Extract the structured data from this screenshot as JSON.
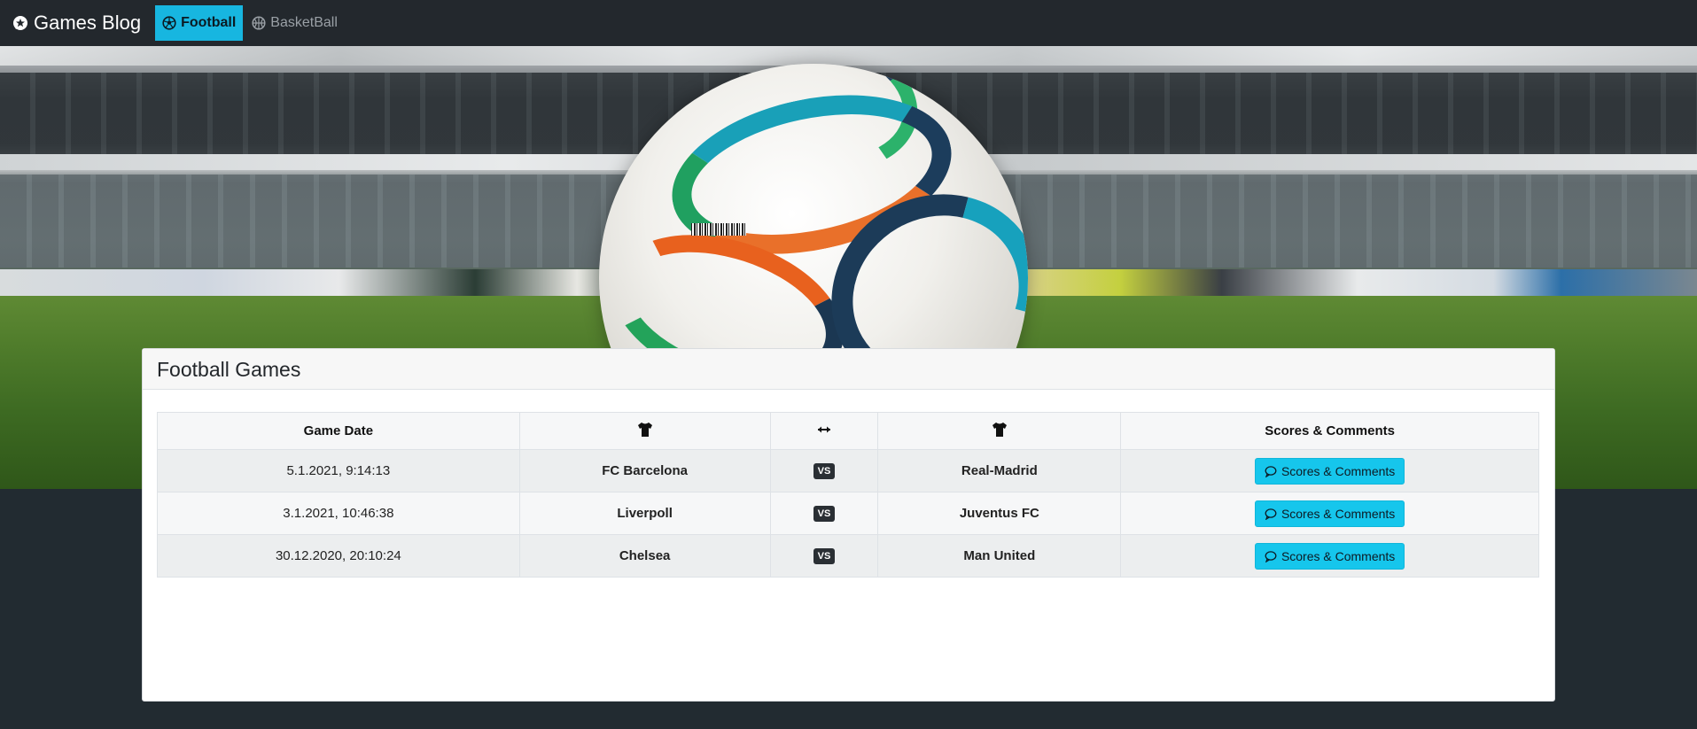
{
  "navbar": {
    "brand": "Games Blog",
    "brand_icon": "chat-icon",
    "items": [
      {
        "label": "Football",
        "icon": "soccer-ball-icon",
        "active": true
      },
      {
        "label": "BasketBall",
        "icon": "basketball-icon",
        "active": false
      }
    ]
  },
  "colors": {
    "navbar_bg": "#23282d",
    "accent": "#17b6e0",
    "page_bg": "#222b31",
    "button": "#16c6ec",
    "vs_badge": "#2a2f34"
  },
  "hero": {
    "image": "football-stadium-ball"
  },
  "card": {
    "title": "Football Games",
    "table": {
      "headers": [
        {
          "label": "Game Date"
        },
        {
          "icon": "shirt-icon"
        },
        {
          "icon": "double-arrow-icon"
        },
        {
          "icon": "shirt-icon"
        },
        {
          "label": "Scores & Comments"
        }
      ],
      "rows": [
        {
          "date": "5.1.2021, 9:14:13",
          "home": "FC Barcelona",
          "vs": "VS",
          "away": "Real-Madrid",
          "button": "Scores & Comments"
        },
        {
          "date": "3.1.2021, 10:46:38",
          "home": "Liverpoll",
          "vs": "VS",
          "away": "Juventus FC",
          "button": "Scores & Comments"
        },
        {
          "date": "30.12.2020, 20:10:24",
          "home": "Chelsea",
          "vs": "VS",
          "away": "Man United",
          "button": "Scores & Comments"
        }
      ]
    }
  }
}
